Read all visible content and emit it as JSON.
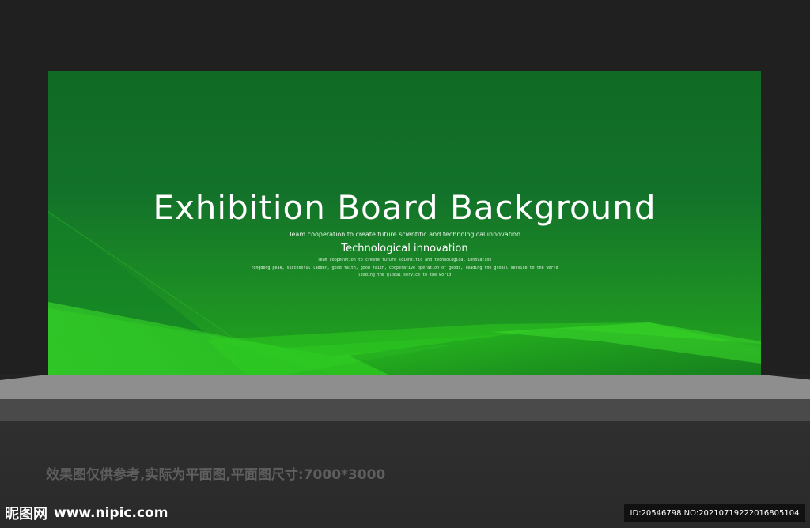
{
  "board": {
    "title": "Exhibition Board Background",
    "subtitle_small": "Team cooperation to create future scientific and technological innovation",
    "subtitle_main": "Technological innovation",
    "line1": "Team cooperation to create future scientific and technological innovation",
    "line2": "Yongdeng peak, successful ladder, good faith, good faith, cooperative operation of goods, leading the global service to the world",
    "line3": "leading the global service to the world"
  },
  "note": "效果图仅供参考,实际为平面图,平面图尺寸:7000*3000",
  "watermark": {
    "logo_text": "昵图网",
    "url": "www.nipic.com"
  },
  "id_strip": "ID:20546798 NO:20210719222016805104",
  "colors": {
    "background": "#232323",
    "board_dark_green": "#106a24",
    "board_bright_green": "#22a81d",
    "floor": "#8e8e8e"
  },
  "icons": {
    "logo": "nipic-logo-icon"
  }
}
